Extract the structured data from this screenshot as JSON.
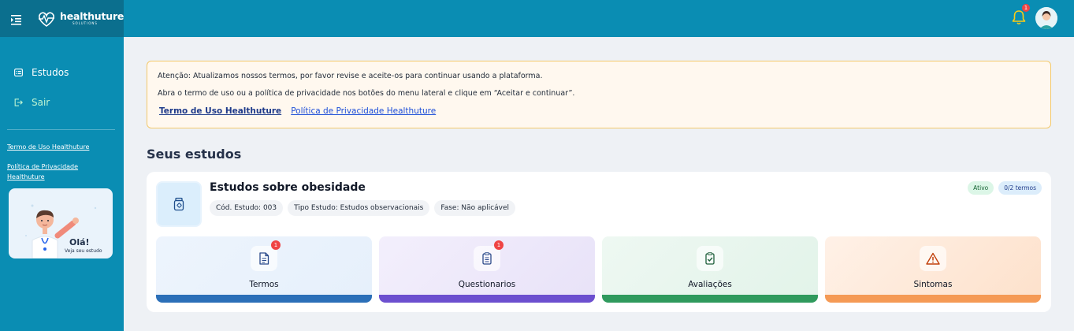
{
  "brand": {
    "name": "healthuture",
    "sub": "SOLUTIONS"
  },
  "sidebar": {
    "items": [
      {
        "label": "Estudos",
        "icon": "list-icon"
      },
      {
        "label": "Sair",
        "icon": "logout-icon"
      }
    ],
    "links": [
      "Termo de Uso Healthuture",
      "Política de Privacidade Healthuture"
    ],
    "hello": {
      "title": "Olá!",
      "subtitle": "Veja seu estudo"
    }
  },
  "topbar": {
    "notification_count": "1"
  },
  "alert": {
    "line1": "Atenção: Atualizamos nossos termos, por favor revise e aceite-os para continuar usando a plataforma.",
    "line2": "Abra o termo de uso ou a política de privacidade nos botões do menu lateral e clique em “Aceitar e continuar”.",
    "link_terms": "Termo de Uso Healthuture",
    "link_privacy": "Política de Privacidade Healthuture"
  },
  "main": {
    "section_title": "Seus estudos",
    "study": {
      "name": "Estudos sobre obesidade",
      "chips": [
        "Cód. Estudo: 003",
        "Tipo Estudo: Estudos observacionais",
        "Fase: Não aplicável"
      ],
      "status": "Ativo",
      "terms": "0/2 termos",
      "tiles": [
        {
          "label": "Termos",
          "badge": "1",
          "icon": "document-icon",
          "accent": "#2b6fb8"
        },
        {
          "label": "Questionarios",
          "badge": "1",
          "icon": "clipboard-list-icon",
          "accent": "#6c4fcf"
        },
        {
          "label": "Avaliações",
          "badge": "",
          "icon": "clipboard-check-icon",
          "accent": "#2f9a5d"
        },
        {
          "label": "Sintomas",
          "badge": "",
          "icon": "warning-icon",
          "accent": "#f59a55"
        }
      ]
    }
  }
}
